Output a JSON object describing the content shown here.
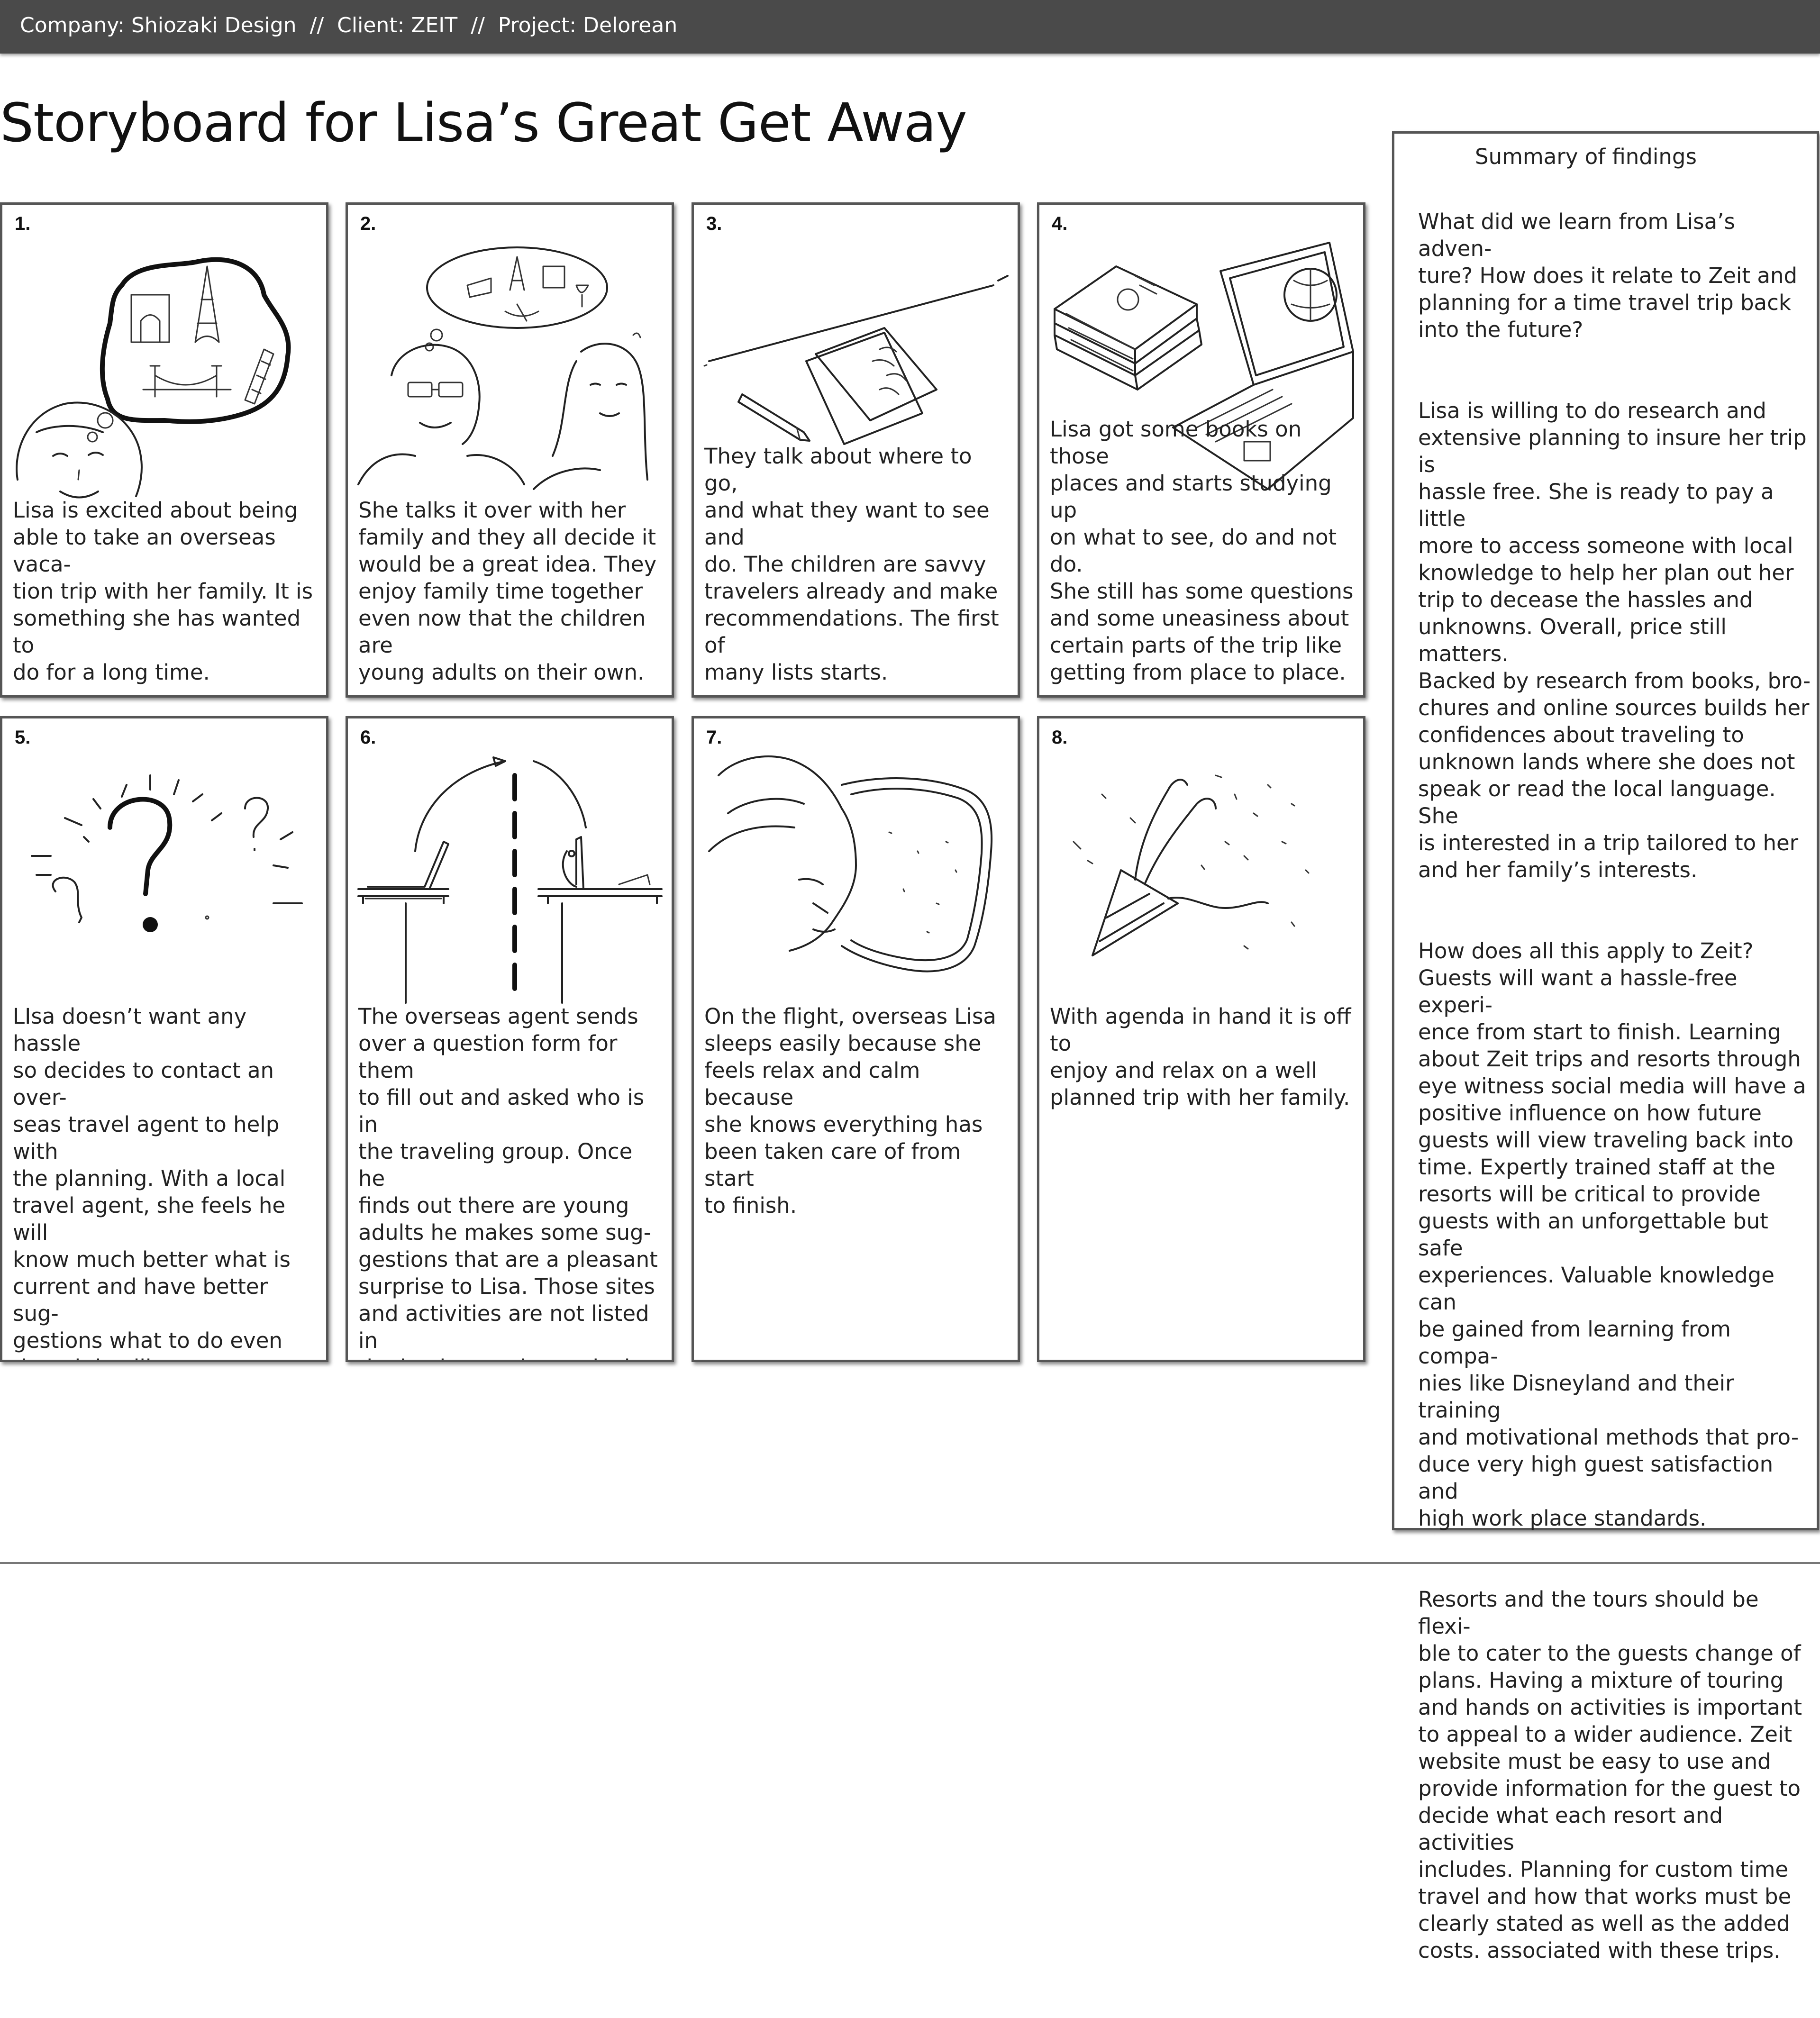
{
  "header": {
    "text": "Company: Shiozaki Design  //  Client: ZEIT  //  Project: Delorean"
  },
  "title": "Storyboard for Lisa’s Great Get Away",
  "panels": [
    {
      "number": "1.",
      "sketch": "lisa-dreaming-of-landmarks-sketch",
      "text": "Lisa is excited about being\nable to take an overseas vaca-\ntion trip with her family.  It is\nsomething she has wanted to\ndo for a long time."
    },
    {
      "number": "2.",
      "sketch": "family-discussion-sketch",
      "text": "She talks it over with her\nfamily and they all decide it\nwould be a great idea.  They\nenjoy family time together\neven now that the children are\nyoung adults on their own."
    },
    {
      "number": "3.",
      "sketch": "pencil-and-list-sketch",
      "text": "They talk about where to go,\nand what they want to see and\ndo.  The children are savvy\ntravelers already and make\nrecommendations.  The first of\nmany lists starts."
    },
    {
      "number": "4.",
      "sketch": "books-and-laptop-sketch",
      "text": "Lisa got some books on those\nplaces and starts studying up\non what to see, do and not do.\nShe still has some questions\nand some uneasiness about\ncertain parts of the trip like\ngetting from place to place."
    },
    {
      "number": "5.",
      "sketch": "question-marks-sketch",
      "text": "LIsa doesn’t want any hassle\nso decides to contact an over-\nseas travel agent to help with\nthe planning.  With a local\ntravel agent, she feels he will\nknow much better what is\ncurrent and have better sug-\ngestions what to do even\nthough it will cost more com-\npared to agent here.   She does\nnot want to figure it out over\nthere as her children have\ndone on their trips."
    },
    {
      "number": "6.",
      "sketch": "form-sent-between-desks-sketch",
      "text": "The overseas agent sends\nover a question form for them\nto fill out and asked who is in\nthe traveling group.  Once he\nfinds out there are young\nadults he makes some sug-\ngestions that are a pleasant\nsurprise to Lisa.  Those sites\nand activities are not listed in\nthe books or other web sites\nshe had visited."
    },
    {
      "number": "7.",
      "sketch": "sleeping-by-airplane-window-sketch",
      "text": "On the flight, overseas Lisa\nsleeps easily because she\nfeels relax and calm because\nshe knows everything has\nbeen taken care of from start\nto finish."
    },
    {
      "number": "8.",
      "sketch": "party-popper-sketch",
      "text": "With agenda in hand it is off to\nenjoy and relax on a well\nplanned trip with her family."
    }
  ],
  "summary": {
    "title": "Summary of findings",
    "paragraphs": [
      "What did we learn from Lisa’s adven-\nture?  How does it relate to Zeit and\nplanning for a time travel trip back\ninto the future?",
      "Lisa is willing to do research and\nextensive planning to insure her trip is\nhassle free.  She is ready to pay a little\nmore to access someone with local\nknowledge to help her plan out her\ntrip to decease the hassles and\nunknowns.  Overall, price still matters.\nBacked by research from books, bro-\nchures and online sources builds her\nconfidences about traveling to\nunknown lands where she does not\nspeak or read the local language.  She\nis interested in a trip tailored to her\nand her family’s interests.",
      "How does all this apply to Zeit?\nGuests will want a hassle-free experi-\nence from start to finish.  Learning\nabout Zeit trips and resorts through\neye witness social media will have a\npositive influence on how future\nguests will view traveling back into\ntime.  Expertly trained staff at the\nresorts will be critical to provide\nguests with an unforgettable but safe\nexperiences.  Valuable knowledge can\nbe gained from learning from compa-\nnies like Disneyland and their training\nand motivational methods that pro-\nduce very high guest satisfaction and\nhigh work place standards.",
      "Resorts and the tours should be flexi-\nble to cater to the guests change of\nplans.  Having a mixture of touring\nand hands on activities is important\nto appeal to a wider audience.  Zeit\nwebsite must be easy to use and\nprovide information for the guest to\ndecide what each resort and activities\nincludes.  Planning for custom time\ntravel and how that works must be\nclearly stated as well as the added\ncosts. associated with these trips."
    ]
  },
  "colors": {
    "header_bg": "#4a4a4a",
    "header_text": "#ffffff",
    "border": "#555555",
    "ink": "#222222"
  }
}
